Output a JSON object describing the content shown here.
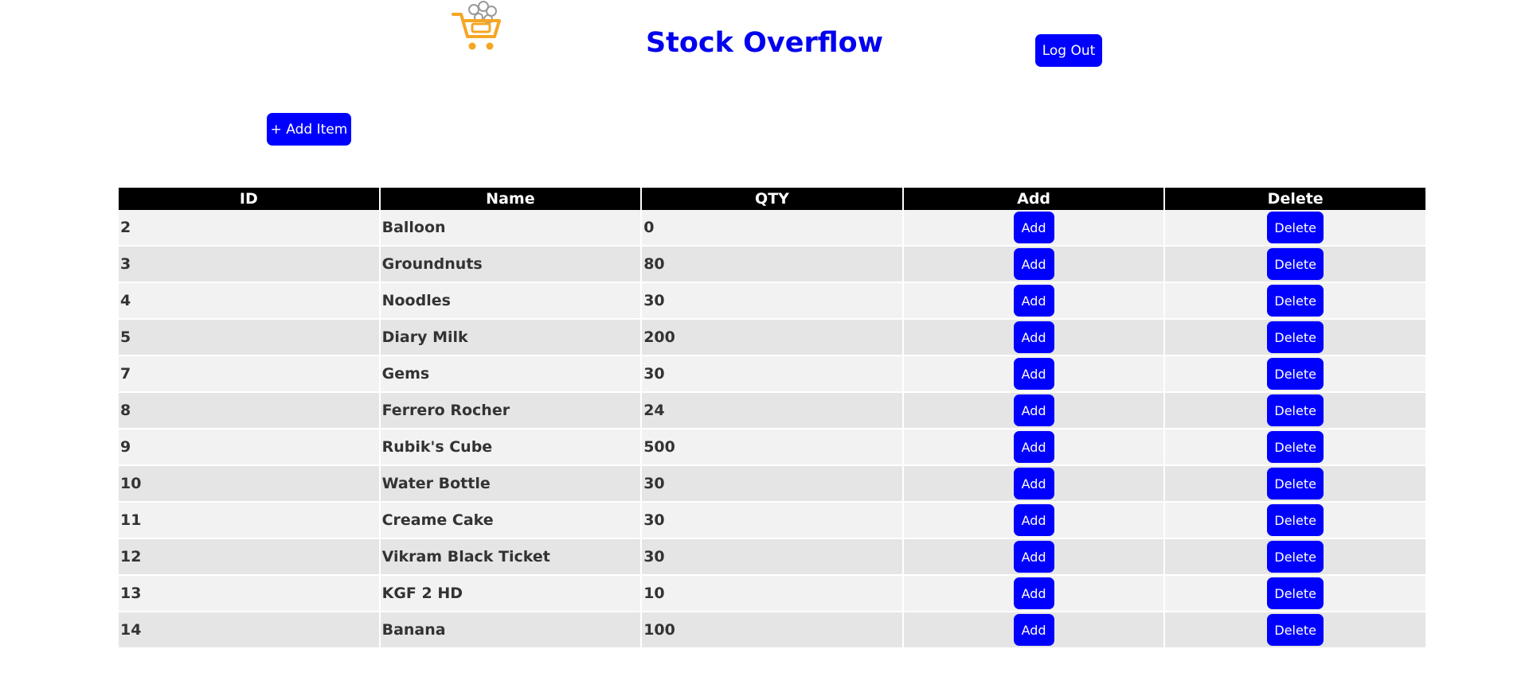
{
  "header": {
    "title": "Stock Overflow",
    "logout_label": "Log Out"
  },
  "toolbar": {
    "add_item_label": "+ Add Item"
  },
  "table": {
    "columns": [
      "ID",
      "Name",
      "QTY",
      "Add",
      "Delete"
    ],
    "add_label": "Add",
    "delete_label": "Delete",
    "rows": [
      {
        "id": "2",
        "name": "Balloon",
        "qty": "0"
      },
      {
        "id": "3",
        "name": "Groundnuts",
        "qty": "80"
      },
      {
        "id": "4",
        "name": "Noodles",
        "qty": "30"
      },
      {
        "id": "5",
        "name": "Diary Milk",
        "qty": "200"
      },
      {
        "id": "7",
        "name": "Gems",
        "qty": "30"
      },
      {
        "id": "8",
        "name": "Ferrero Rocher",
        "qty": "24"
      },
      {
        "id": "9",
        "name": "Rubik's Cube",
        "qty": "500"
      },
      {
        "id": "10",
        "name": "Water Bottle",
        "qty": "30"
      },
      {
        "id": "11",
        "name": "Creame Cake",
        "qty": "30"
      },
      {
        "id": "12",
        "name": "Vikram Black Ticket",
        "qty": "30"
      },
      {
        "id": "13",
        "name": "KGF 2 HD",
        "qty": "10"
      },
      {
        "id": "14",
        "name": "Banana",
        "qty": "100"
      }
    ]
  },
  "colors": {
    "accent": "#0000ff",
    "title": "#0000ee",
    "header_bg": "#000000",
    "row_odd": "#f2f2f2",
    "row_even": "#e5e5e5",
    "logo_cart": "#f5a623"
  },
  "icons": {
    "logo": "shopping-cart-icon"
  }
}
